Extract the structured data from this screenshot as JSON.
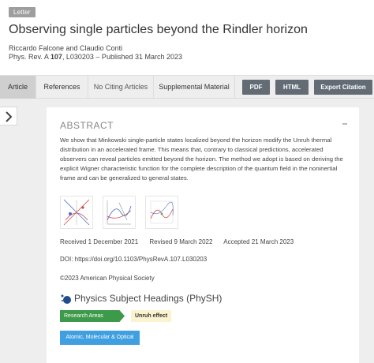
{
  "article": {
    "badge": "Letter",
    "title": "Observing single particles beyond the Rindler horizon",
    "authors": "Riccardo Falcone and Claudio Conti",
    "journal_prefix": "Phys. Rev. A ",
    "volume": "107",
    "citation_rest": ", L030203 – Published 31 March 2023"
  },
  "nav": {
    "tabs": [
      "Article",
      "References",
      "No Citing Articles",
      "Supplemental Material"
    ],
    "buttons": [
      "PDF",
      "HTML",
      "Export Citation"
    ]
  },
  "abstract": {
    "heading": "ABSTRACT",
    "text": "We show that Minkowski single-particle states localized beyond the horizon modify the Unruh thermal distribution in an accelerated frame. This means that, contrary to classical predictions, accelerated observers can reveal particles emitted beyond the horizon. The method we adopt is based on deriving the explicit Wigner characteristic function for the complete description of the quantum field in the noninertial frame and can be generalized to general states."
  },
  "dates": {
    "received": "Received 1 December 2021",
    "revised": "Revised 9 March 2022",
    "accepted": "Accepted 21 March 2023"
  },
  "doi": "DOI:   https://doi.org/10.1103/PhysRevA.107.L030203",
  "copyright": "©2023 American Physical Society",
  "physh": {
    "title": "Physics Subject Headings (PhySH)",
    "area_label": "Research Areas",
    "area_value": "Unruh effect",
    "subject_button": "Atomic, Molecular & Optical"
  },
  "colors": {
    "active_tab": "#cfcfcf",
    "nav_button": "#636b74",
    "research_area": "#3d9a4a",
    "area_tag": "#fbf3d0",
    "subject_button": "#3f9fe0"
  },
  "icons": [
    "chevron-right-icon",
    "collapse-minus-icon",
    "physh-logo-icon"
  ]
}
